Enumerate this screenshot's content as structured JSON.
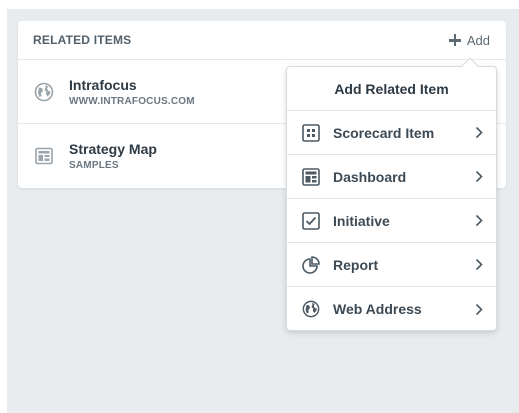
{
  "panel": {
    "title": "RELATED ITEMS",
    "add_label": "Add"
  },
  "items": [
    {
      "name": "Intrafocus",
      "subtitle": "WWW.INTRAFOCUS.COM",
      "icon": "globe-icon"
    },
    {
      "name": "Strategy Map",
      "subtitle": "SAMPLES",
      "icon": "dashboard-icon"
    }
  ],
  "menu": {
    "title": "Add Related Item",
    "items": [
      {
        "label": "Scorecard Item",
        "icon": "scorecard-icon"
      },
      {
        "label": "Dashboard",
        "icon": "dashboard-icon"
      },
      {
        "label": "Initiative",
        "icon": "checkbox-icon"
      },
      {
        "label": "Report",
        "icon": "pie-chart-icon"
      },
      {
        "label": "Web Address",
        "icon": "globe-icon"
      }
    ]
  },
  "colors": {
    "background": "#e8ecee",
    "text": "#2e3a44",
    "muted": "#6b7780"
  }
}
